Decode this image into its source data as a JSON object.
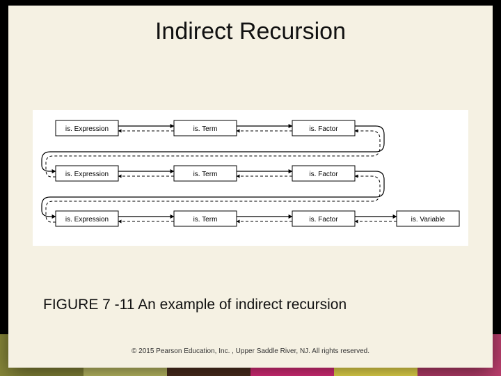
{
  "title": "Indirect Recursion",
  "caption": "FIGURE 7 -11 An example of indirect recursion",
  "copyright": "© 2015 Pearson Education, Inc. , Upper Saddle River, NJ.  All rights reserved.",
  "diagram": {
    "row1": {
      "b1": "is. Expression",
      "b2": "is. Term",
      "b3": "is. Factor"
    },
    "row2": {
      "b1": "is. Expression",
      "b2": "is. Term",
      "b3": "is. Factor"
    },
    "row3": {
      "b1": "is. Expression",
      "b2": "is. Term",
      "b3": "is. Factor",
      "b4": "is. Variable"
    }
  }
}
